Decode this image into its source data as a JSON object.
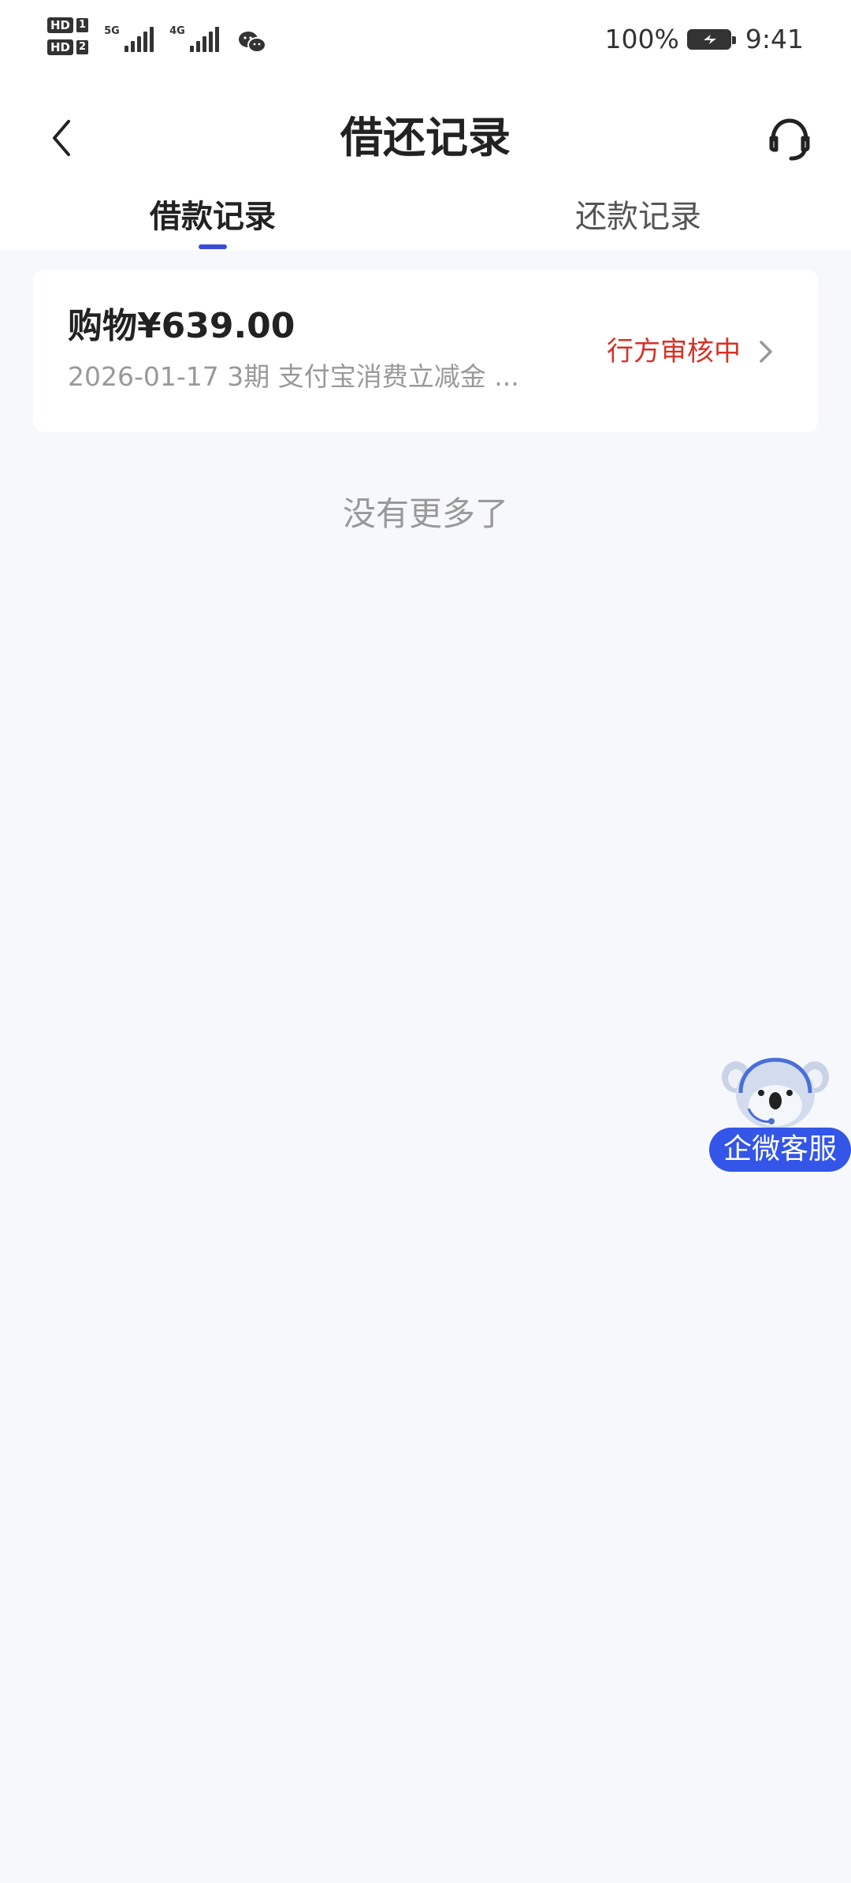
{
  "status_bar": {
    "sim1": "HD",
    "sim1_num": "1",
    "sim2": "HD",
    "sim2_num": "2",
    "net1": "5G",
    "net2": "4G",
    "battery": "100%",
    "time": "9:41"
  },
  "header": {
    "title": "借还记录",
    "back_icon": "chevron-left-icon",
    "service_icon": "headset-icon"
  },
  "tabs": [
    {
      "label": "借款记录",
      "active": true
    },
    {
      "label": "还款记录",
      "active": false
    }
  ],
  "records": [
    {
      "amount": "购物¥639.00",
      "subtitle": "2026-01-17 3期  支付宝消费立减金 ...",
      "status": "行方审核中"
    }
  ],
  "footer_text": "没有更多了",
  "float_service": {
    "label": "企微客服"
  },
  "colors": {
    "accent": "#3b4bd8",
    "status_red": "#d93025",
    "float_blue": "#3355e8",
    "background": "#f7f8fc"
  }
}
